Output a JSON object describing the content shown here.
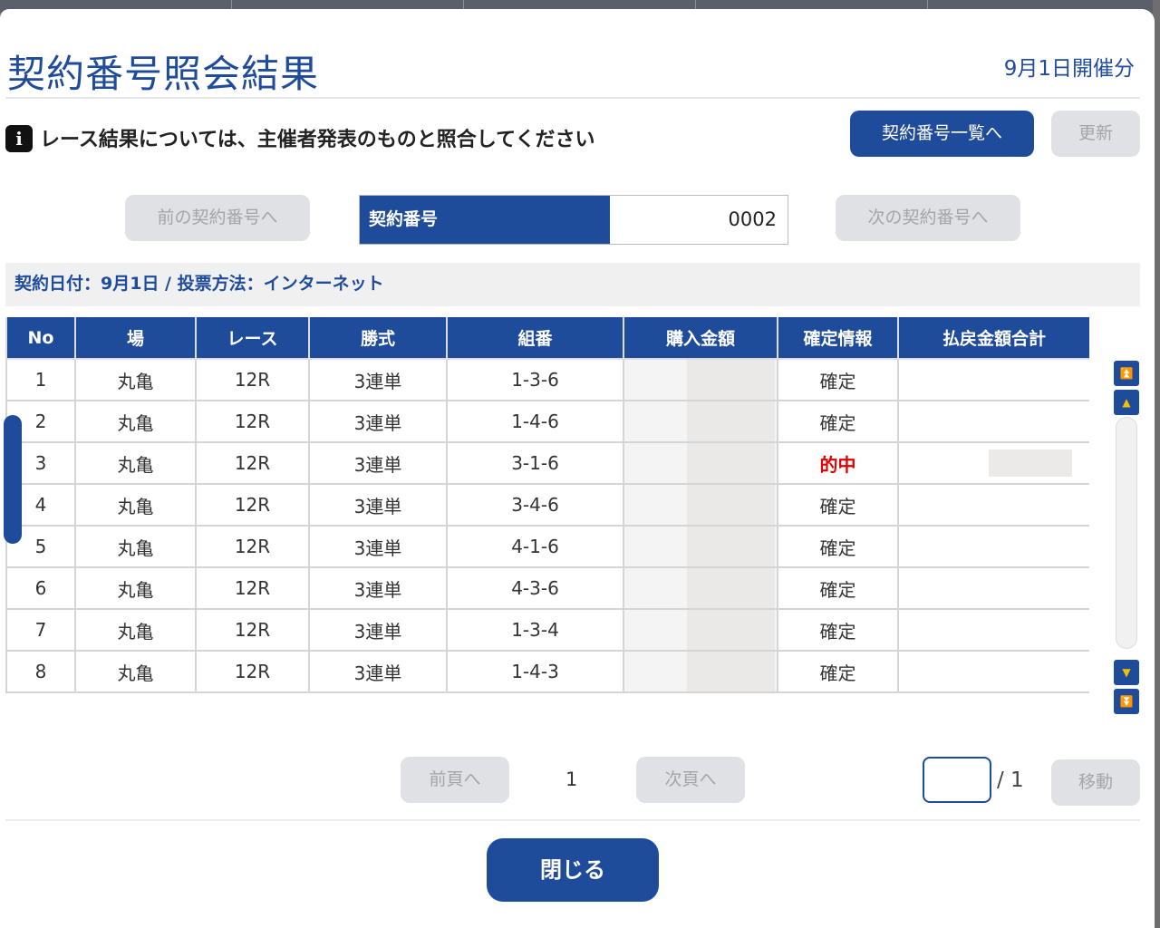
{
  "title": "契約番号照会結果",
  "event_date_label": "9月1日開催分",
  "info": {
    "icon": "info-icon",
    "icon_glyph": "i",
    "text": "レース結果については、主催者発表のものと照合してください"
  },
  "buttons": {
    "contract_list": "契約番号一覧へ",
    "refresh": "更新",
    "prev_contract": "前の契約番号へ",
    "next_contract": "次の契約番号へ",
    "prev_page": "前頁へ",
    "next_page": "次頁へ",
    "move": "移動",
    "close": "閉じる"
  },
  "contract": {
    "label": "契約番号",
    "value": "0002"
  },
  "meta": "契約日付：9月1日 / 投票方法：インターネット",
  "table": {
    "headers": [
      "No",
      "場",
      "レース",
      "勝式",
      "組番",
      "購入金額",
      "確定情報",
      "払戻金額合計"
    ],
    "rows": [
      {
        "no": "1",
        "venue": "丸亀",
        "race": "12R",
        "type": "3連単",
        "combo": "1-3-6",
        "status": "確定"
      },
      {
        "no": "2",
        "venue": "丸亀",
        "race": "12R",
        "type": "3連単",
        "combo": "1-4-6",
        "status": "確定"
      },
      {
        "no": "3",
        "venue": "丸亀",
        "race": "12R",
        "type": "3連単",
        "combo": "3-1-6",
        "status": "的中"
      },
      {
        "no": "4",
        "venue": "丸亀",
        "race": "12R",
        "type": "3連単",
        "combo": "3-4-6",
        "status": "確定"
      },
      {
        "no": "5",
        "venue": "丸亀",
        "race": "12R",
        "type": "3連単",
        "combo": "4-1-6",
        "status": "確定"
      },
      {
        "no": "6",
        "venue": "丸亀",
        "race": "12R",
        "type": "3連単",
        "combo": "4-3-6",
        "status": "確定"
      },
      {
        "no": "7",
        "venue": "丸亀",
        "race": "12R",
        "type": "3連単",
        "combo": "1-3-4",
        "status": "確定"
      },
      {
        "no": "8",
        "venue": "丸亀",
        "race": "12R",
        "type": "3連単",
        "combo": "1-4-3",
        "status": "確定"
      }
    ]
  },
  "scrollbar": {
    "icons": [
      "scroll-top-icon",
      "scroll-up-icon",
      "scroll-down-icon",
      "scroll-bottom-icon"
    ]
  },
  "pagination": {
    "current": "1",
    "total": "/ 1",
    "input_value": ""
  },
  "colors": {
    "primary": "#1f4b9b",
    "hit": "#e00000",
    "disabled_bg": "#dfe1e4",
    "scroll_arrow": "#f2c200"
  }
}
